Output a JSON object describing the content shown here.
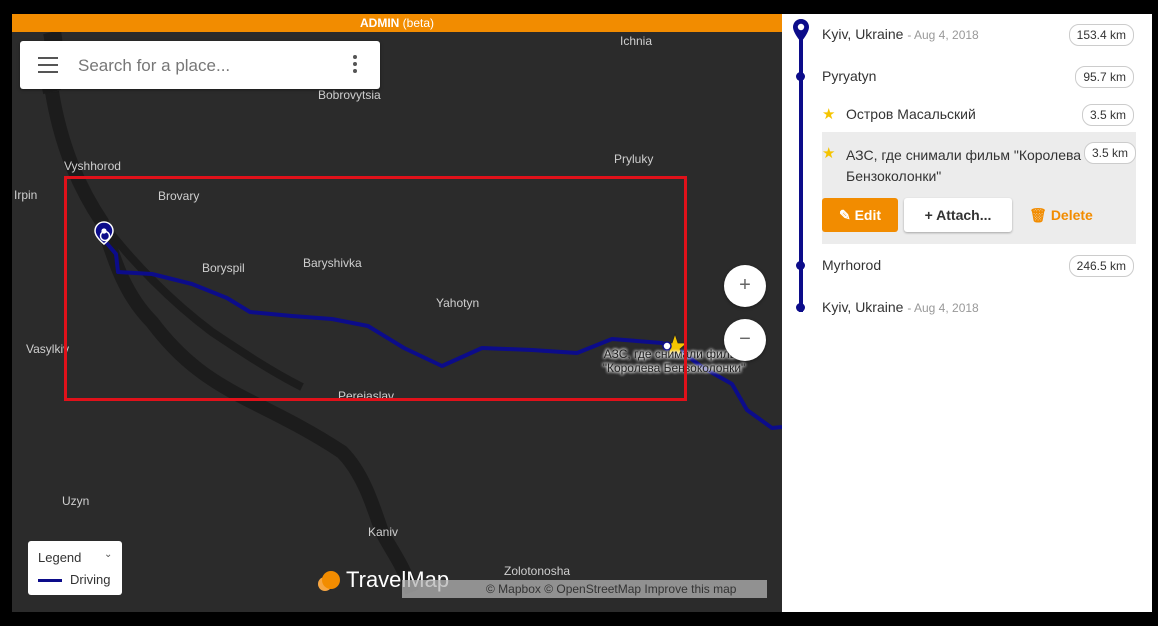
{
  "admin_bar": {
    "label": "ADMIN",
    "beta": "(beta)"
  },
  "search": {
    "placeholder": "Search for a place..."
  },
  "map": {
    "labels": {
      "ichnia": "Ichnia",
      "bobrovytsia": "Bobrovytsia",
      "vyshhorod": "Vyshhorod",
      "pryluky": "Pryluky",
      "irpin": "Irpin",
      "brovary": "Brovary",
      "boryspil": "Boryspil",
      "baryshivka": "Baryshivka",
      "yahotyn": "Yahotyn",
      "vasylkiv": "Vasylkiv",
      "pereiaslav": "Pereiaslav",
      "uzyn": "Uzyn",
      "kaniv": "Kaniv",
      "zolotonosha": "Zolotonosha"
    },
    "gas_station_label": "АЗС, где снимали фильм \"Королева Бензоколонки\"",
    "zoom_in": "+",
    "zoom_out": "−",
    "legend": {
      "title": "Legend",
      "item": "Driving",
      "color": "#0c0c8a"
    },
    "logo": "TravelMap",
    "attribution": "© Mapbox © OpenStreetMap Improve this map",
    "route_color": "#0c0c8a",
    "highlight_color": "#e0111a"
  },
  "panel": {
    "stops": [
      {
        "name": "Kyiv, Ukraine",
        "date": "- Aug 4, 2018",
        "distance": "153.4 km"
      },
      {
        "name": "Pyryatyn",
        "distance": "95.7 km"
      },
      {
        "name": "Остров Масальский",
        "distance": "3.5 km"
      },
      {
        "name": "АЗС, где снимали фильм \"Королева Бензоколонки\"",
        "distance": "3.5 km"
      },
      {
        "name": "Myrhorod",
        "distance": "246.5 km"
      },
      {
        "name": "Kyiv, Ukraine",
        "date": "- Aug 4, 2018"
      }
    ],
    "actions": {
      "edit": "Edit",
      "attach": "Attach...",
      "delete": "Delete"
    }
  }
}
